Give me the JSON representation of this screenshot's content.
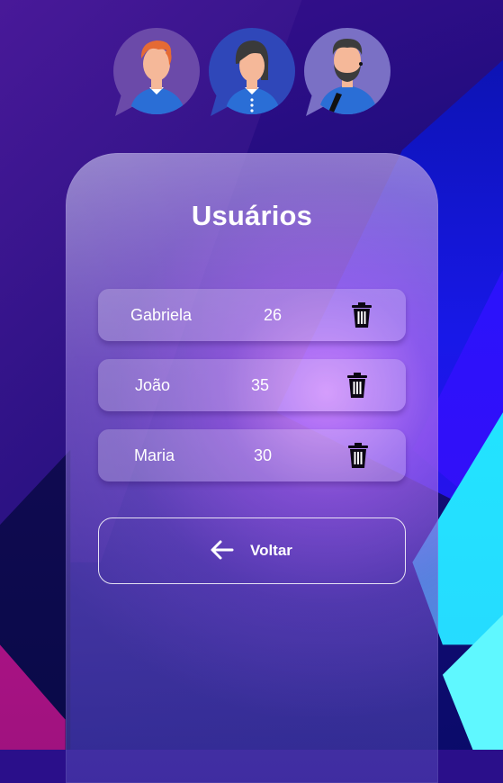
{
  "screen": {
    "title": "Usuários"
  },
  "avatars": [
    {
      "icon": "redhead-man-avatar-icon",
      "bubble_color": "#6b4aa9"
    },
    {
      "icon": "dark-hair-woman-avatar-icon",
      "bubble_color": "#2f47b9"
    },
    {
      "icon": "bearded-man-avatar-icon",
      "bubble_color": "#7a70c5"
    }
  ],
  "users": [
    {
      "name": "Gabriela",
      "age": "26",
      "delete_icon": "trash-icon"
    },
    {
      "name": "João",
      "age": "35",
      "delete_icon": "trash-icon"
    },
    {
      "name": "Maria",
      "age": "30",
      "delete_icon": "trash-icon"
    }
  ],
  "back_button": {
    "label": "Voltar",
    "icon": "arrow-left-icon"
  },
  "colors": {
    "text": "#ffffff",
    "icon_dark": "#0b0612",
    "shirt_blue": "#2a6ed6",
    "skin": "#f5b899"
  }
}
